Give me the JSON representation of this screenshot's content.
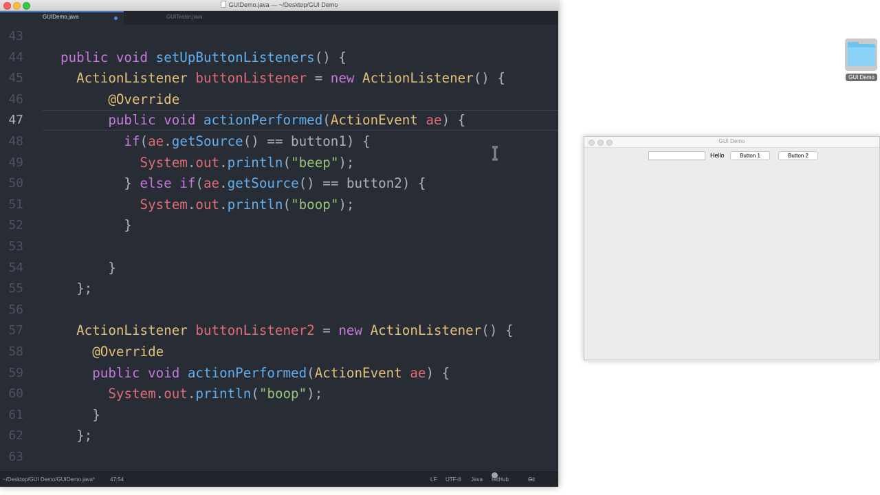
{
  "editor": {
    "window_title": "GUIDemo.java — ~/Desktop/GUI Demo",
    "tabs": [
      {
        "label": "GUIDemo.java",
        "modified": true
      },
      {
        "label": "GUITester.java",
        "modified": false
      }
    ],
    "current_line": 47,
    "lines": [
      {
        "n": "43",
        "code": ""
      },
      {
        "n": "44",
        "code": "public void setUpButtonListeners() {"
      },
      {
        "n": "45",
        "code": "  ActionListener buttonListener = new ActionListener() {"
      },
      {
        "n": "46",
        "code": "      @Override"
      },
      {
        "n": "47",
        "code": "      public void actionPerformed(ActionEvent ae) {"
      },
      {
        "n": "48",
        "code": "        if(ae.getSource() == button1) {"
      },
      {
        "n": "49",
        "code": "          System.out.println(\"beep\");"
      },
      {
        "n": "50",
        "code": "        } else if(ae.getSource() == button2) {"
      },
      {
        "n": "51",
        "code": "          System.out.println(\"boop\");"
      },
      {
        "n": "52",
        "code": "        }"
      },
      {
        "n": "53",
        "code": ""
      },
      {
        "n": "54",
        "code": "      }"
      },
      {
        "n": "55",
        "code": "  };"
      },
      {
        "n": "56",
        "code": ""
      },
      {
        "n": "57",
        "code": "  ActionListener buttonListener2 = new ActionListener() {"
      },
      {
        "n": "58",
        "code": "    @Override"
      },
      {
        "n": "59",
        "code": "    public void actionPerformed(ActionEvent ae) {"
      },
      {
        "n": "60",
        "code": "      System.out.println(\"boop\");"
      },
      {
        "n": "61",
        "code": "    }"
      },
      {
        "n": "62",
        "code": "  };"
      },
      {
        "n": "63",
        "code": ""
      }
    ],
    "status": {
      "path": "~/Desktop/GUI Demo/GUIDemo.java*",
      "cursor": "47:54",
      "line_ending": "LF",
      "encoding": "UTF-8",
      "grammar": "Java",
      "github": "GitHub",
      "git": "Git (0)"
    },
    "colors": {
      "background": "#282c34",
      "keyword": "#c678dd",
      "type": "#e5c07b",
      "function": "#61afef",
      "variable": "#e06c75",
      "string": "#98c379"
    }
  },
  "desktop": {
    "folder_label": "GUI Demo"
  },
  "gui_demo": {
    "title": "GUI Demo",
    "textfield_value": "",
    "label": "Hello",
    "button1": "Button 1",
    "button2": "Button 2"
  }
}
